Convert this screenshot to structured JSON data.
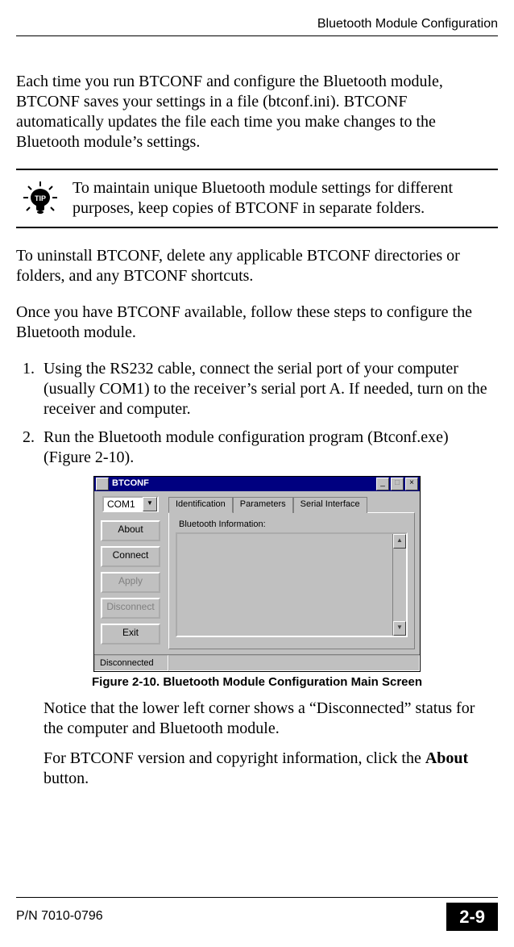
{
  "header": {
    "section": "Bluetooth Module Configuration"
  },
  "body": {
    "p1": "Each time you run BTCONF and configure the Bluetooth module, BTCONF saves your settings in a file (btconf.ini). BTCONF automatically updates the file each time you make changes to the Bluetooth module’s settings.",
    "tip_label": "TIP",
    "tip_text": "To maintain unique Bluetooth module settings for different purposes, keep copies of BTCONF in separate folders.",
    "p2": "To uninstall BTCONF, delete any applicable BTCONF directories or folders, and any BTCONF shortcuts.",
    "p3": "Once you have BTCONF available, follow these steps to configure the Bluetooth module.",
    "step1": "Using the RS232 cable, connect the serial port of your computer (usually COM1) to the receiver’s serial port A. If needed, turn on the receiver and computer.",
    "step2": "Run the Bluetooth module configuration program (Btconf.exe) (Figure 2-10).",
    "fig_caption": "Figure 2-10. Bluetooth Module Configuration Main Screen",
    "after1": "Notice that the lower left corner shows a “Disconnected” status for the computer and Bluetooth module.",
    "after2_a": "For BTCONF version and copyright information, click the ",
    "after2_bold": "About",
    "after2_b": " button."
  },
  "btconf": {
    "title": "BTCONF",
    "port": "COM1",
    "buttons": {
      "about": "About",
      "connect": "Connect",
      "apply": "Apply",
      "disconnect": "Disconnect",
      "exit": "Exit"
    },
    "tabs": {
      "identification": "Identification",
      "parameters": "Parameters",
      "serial": "Serial Interface"
    },
    "group_label": "Bluetooth Information:",
    "status": "Disconnected"
  },
  "footer": {
    "part": "P/N 7010-0796",
    "page": "2-9"
  }
}
